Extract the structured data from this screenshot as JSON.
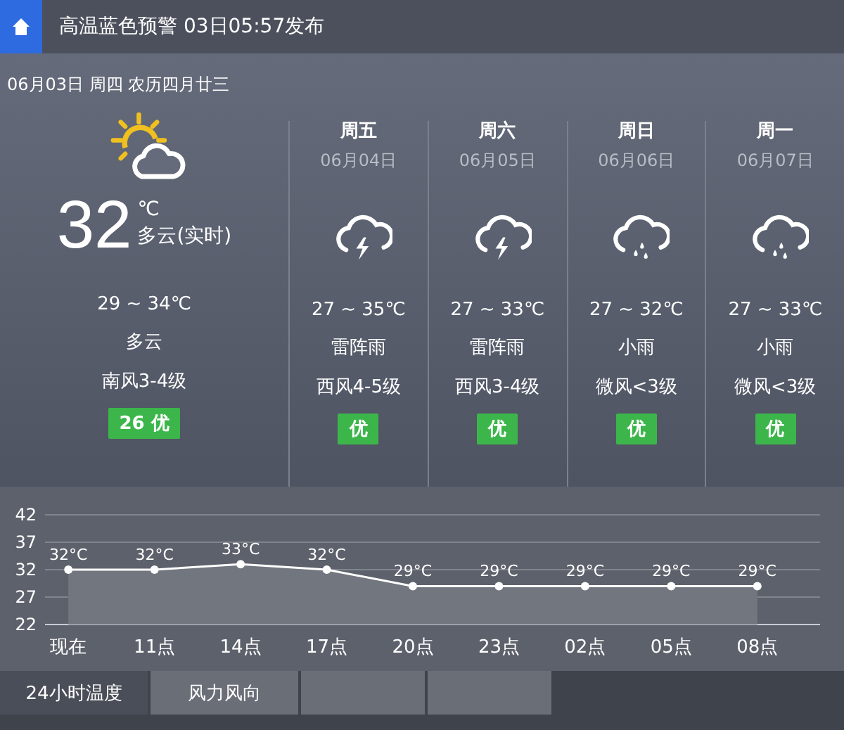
{
  "alert": {
    "text": "高温蓝色预警 03日05:57发布"
  },
  "today": {
    "date": "06月03日 周四 农历四月廿三",
    "kind": "partly-cloudy",
    "temp": "32",
    "unit": "℃",
    "condition_now": "多云(实时)",
    "range": "29 ~ 34℃",
    "condition": "多云",
    "wind": "南风3-4级",
    "aqi": "26 优"
  },
  "forecast": [
    {
      "weekday": "周五",
      "date": "06月04日",
      "kind": "thunder",
      "range": "27 ~ 35℃",
      "condition": "雷阵雨",
      "wind": "西风4-5级",
      "aqi": "优"
    },
    {
      "weekday": "周六",
      "date": "06月05日",
      "kind": "thunder",
      "range": "27 ~ 33℃",
      "condition": "雷阵雨",
      "wind": "西风3-4级",
      "aqi": "优"
    },
    {
      "weekday": "周日",
      "date": "06月06日",
      "kind": "rain",
      "range": "27 ~ 32℃",
      "condition": "小雨",
      "wind": "微风<3级",
      "aqi": "优"
    },
    {
      "weekday": "周一",
      "date": "06月07日",
      "kind": "rain",
      "range": "27 ~ 33℃",
      "condition": "小雨",
      "wind": "微风<3级",
      "aqi": "优"
    }
  ],
  "chart": {
    "chart_data": {
      "type": "line",
      "categories": [
        "现在",
        "11点",
        "14点",
        "17点",
        "20点",
        "23点",
        "02点",
        "05点",
        "08点"
      ],
      "series": [
        {
          "color": "#ffffff",
          "marker": true,
          "values": [
            32,
            32,
            33,
            32,
            29,
            29,
            29,
            29,
            29
          ]
        }
      ],
      "ylim": [
        22,
        42
      ],
      "grid": true,
      "yticks": [
        22,
        27,
        32,
        37,
        42
      ],
      "value_labels": [
        "32°C",
        "32°C",
        "33°C",
        "32°C",
        "29°C",
        "29°C",
        "29°C",
        "29°C",
        "29°C"
      ]
    }
  },
  "tabs": [
    {
      "label": "24小时温度",
      "selected": true
    },
    {
      "label": "风力风向",
      "selected": false
    },
    {
      "selected": false
    },
    {
      "selected": false
    }
  ]
}
